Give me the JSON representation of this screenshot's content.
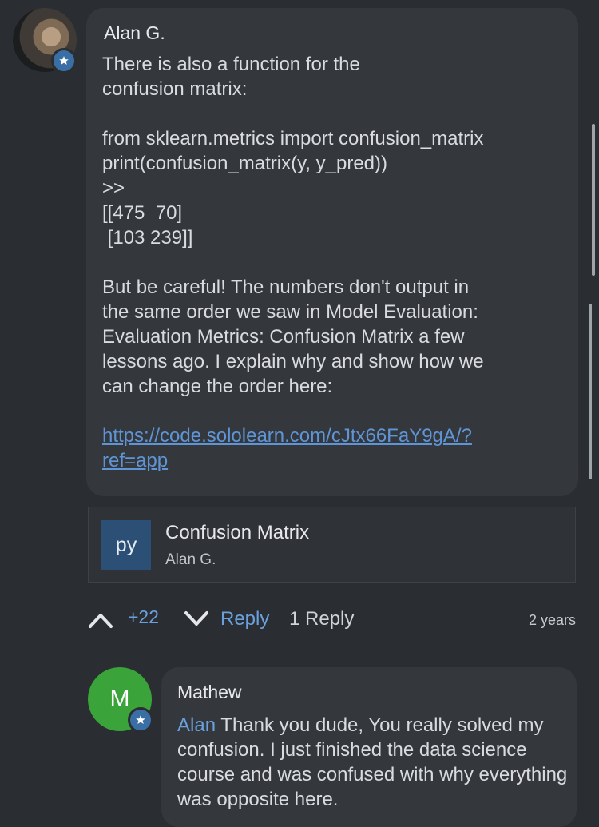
{
  "comment": {
    "author": "Alan G.",
    "body_text": "There is also a function for the\nconfusion matrix:\n\nfrom sklearn.metrics import confusion_matrix\nprint(confusion_matrix(y, y_pred))\n>>\n[[475  70]\n [103 239]]\n\nBut be careful! The numbers don't output in\nthe same order we saw in Model Evaluation:\nEvaluation Metrics: Confusion Matrix a few\nlessons ago. I explain why and show how we\ncan change the order here:\n\n",
    "link": "https://code.sololearn.com/cJtx66FaY9gA/?\nref=app",
    "code_card": {
      "badge": "py",
      "title": "Confusion Matrix",
      "subtitle": "Alan G."
    },
    "votes": "+22",
    "reply_label": "Reply",
    "reply_count": "1 Reply",
    "age": "2 years"
  },
  "reply": {
    "avatar_initial": "M",
    "author": "Mathew",
    "mention": "Alan",
    "text": " Thank you dude, You really solved my confusion. I just finished the data science course and was confused with why everything was opposite here."
  },
  "colors": {
    "background": "#2a2d31",
    "bubble": "#34383d",
    "accent": "#6aa1dd",
    "avatar_green": "#3aa339",
    "py_badge": "#2c4f75"
  },
  "icons": [
    "badge-star-icon",
    "upvote-chevron-icon",
    "downvote-chevron-icon"
  ]
}
